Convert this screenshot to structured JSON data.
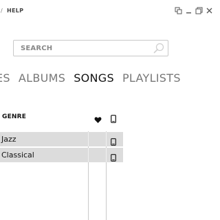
{
  "menubar": {
    "separator": "/",
    "help_label": "HELP"
  },
  "search": {
    "placeholder": "SEARCH",
    "value": ""
  },
  "tabs": [
    {
      "label": "ES",
      "active": false
    },
    {
      "label": "ALBUMS",
      "active": false
    },
    {
      "label": "SONGS",
      "active": true
    },
    {
      "label": "PLAYLISTS",
      "active": false
    }
  ],
  "table": {
    "column_genre": "GENRE",
    "column_favorite_icon": "heart-icon",
    "column_device_icon": "phone-icon",
    "rows": [
      {
        "genre": "Jazz"
      },
      {
        "genre": "Classical"
      }
    ]
  },
  "icons": {
    "window_controls": [
      "miniplayer-icon",
      "minimize-icon",
      "restore-icon",
      "close-icon"
    ],
    "search": "search-icon"
  },
  "colors": {
    "row_bg": "#dcdcdc",
    "inactive_tab": "#777777",
    "active_tab": "#111111"
  }
}
